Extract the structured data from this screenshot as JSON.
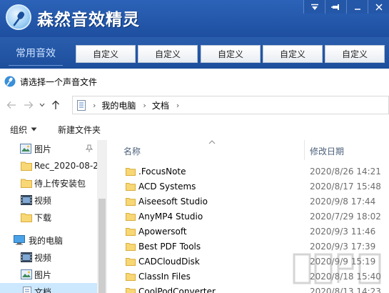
{
  "app": {
    "title": "森然音效精灵",
    "tabs": {
      "common": "常用音效",
      "custom": [
        "自定义",
        "自定义",
        "自定义",
        "自定义",
        "自定义"
      ]
    }
  },
  "dialog": {
    "title": "请选择一个声音文件",
    "breadcrumb": [
      "我的电脑",
      "文档"
    ],
    "toolbar": {
      "organize": "组织",
      "new_folder": "新建文件夹"
    },
    "nav_items": [
      {
        "label": "图片",
        "icon": "pictures-icon",
        "pinned": true
      },
      {
        "label": "Rec_2020-08-2",
        "icon": "folder-icon"
      },
      {
        "label": "待上传安装包",
        "icon": "folder-icon"
      },
      {
        "label": "视频",
        "icon": "videos-icon"
      },
      {
        "label": "下载",
        "icon": "folder-icon"
      },
      {
        "label": "我的电脑",
        "icon": "computer-icon"
      },
      {
        "label": "视频",
        "icon": "videos-icon"
      },
      {
        "label": "图片",
        "icon": "pictures-icon"
      },
      {
        "label": "文档",
        "icon": "documents-icon",
        "selected": true
      }
    ],
    "columns": {
      "name": "名称",
      "modified": "修改日期"
    },
    "files": [
      {
        "name": ".FocusNote",
        "modified": "2020/8/26 14:21"
      },
      {
        "name": "ACD Systems",
        "modified": "2020/8/17 15:48"
      },
      {
        "name": "Aiseesoft Studio",
        "modified": "2020/9/8 17:44"
      },
      {
        "name": "AnyMP4 Studio",
        "modified": "2020/7/29 18:02"
      },
      {
        "name": "Apowersoft",
        "modified": "2020/9/3 11:46"
      },
      {
        "name": "Best PDF Tools",
        "modified": "2020/9/3 17:39"
      },
      {
        "name": "CADCloudDisk",
        "modified": "2020/9/9 15:19"
      },
      {
        "name": "ClassIn Files",
        "modified": "2020/8/18 15:40"
      },
      {
        "name": "CoolPodConverter",
        "modified": "2020/8/13 14:23"
      }
    ]
  },
  "colors": {
    "header_blue": "#1e4fa0",
    "selection": "#cce8ff",
    "folder_yellow": "#f8d775"
  }
}
